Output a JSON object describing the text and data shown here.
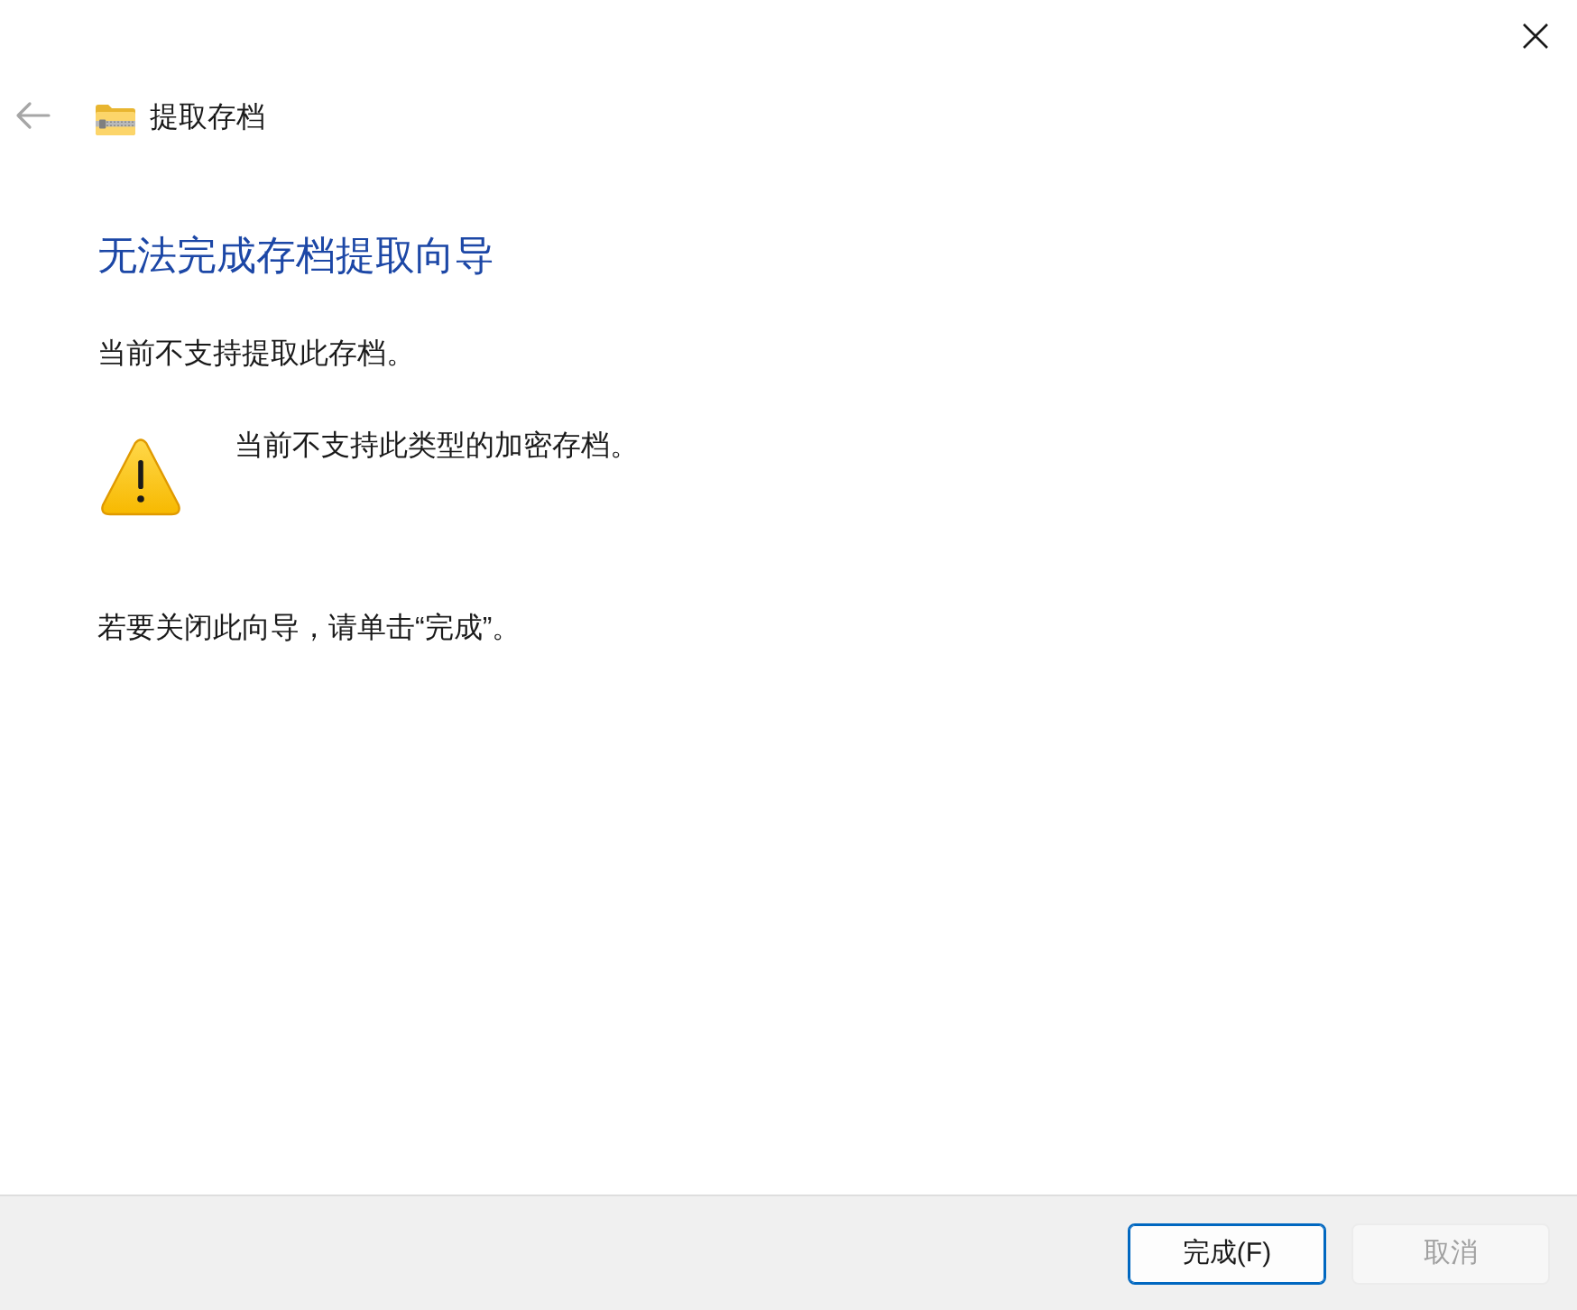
{
  "window": {
    "title": "提取存档",
    "back": {
      "disabled": true
    }
  },
  "heading": "无法完成存档提取向导",
  "message": "当前不支持提取此存档。",
  "details": [
    {
      "kind": "warning",
      "text": "当前不支持此类型的加密存档。"
    }
  ],
  "footer_note": "若要关闭此向导，请单击“完成”。",
  "buttons": [
    {
      "label": "完成(F)",
      "focused": true,
      "disabled": false
    },
    {
      "label": "取消",
      "focused": false,
      "disabled": true
    }
  ]
}
